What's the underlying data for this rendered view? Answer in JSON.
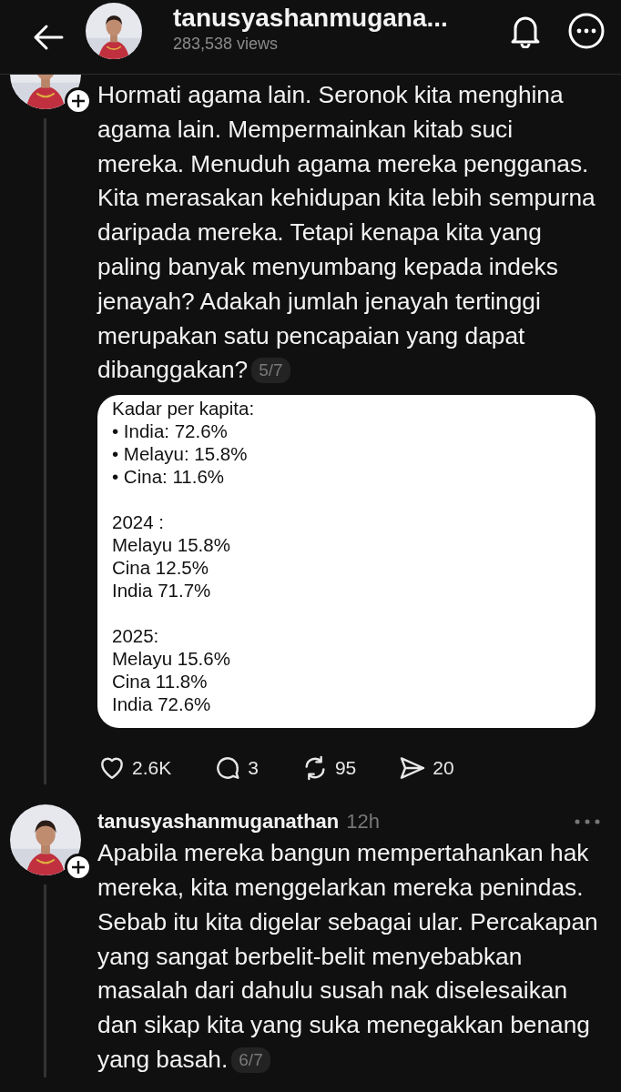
{
  "header": {
    "username": "tanusyashanmugana...",
    "views": "283,538 views"
  },
  "posts": [
    {
      "body": "Hormati agama lain. Seronok kita menghina agama lain. Mempermainkan kitab suci mereka. Menuduh agama mereka pengganas. Kita merasakan kehidupan kita lebih sempurna daripada mereka. Tetapi kenapa kita yang paling banyak menyumbang kepada indeks jenayah? Adakah jumlah jenayah tertinggi merupakan satu pencapaian yang dapat dibanggakan?",
      "counter": "5/7",
      "image_text": [
        [
          "Kadar per kapita:",
          "• India: 72.6%",
          "• Melayu: 15.8%",
          "• Cina: 11.6%"
        ],
        [
          "2024 :",
          "Melayu 15.8%",
          "Cina 12.5%",
          "India 71.7%"
        ],
        [
          "2025:",
          "Melayu 15.6%",
          "Cina 11.8%",
          "India 72.6%"
        ]
      ],
      "actions": [
        {
          "kind": "like",
          "count": "2.6K"
        },
        {
          "kind": "reply",
          "count": "3"
        },
        {
          "kind": "repost",
          "count": "95"
        },
        {
          "kind": "share",
          "count": "20"
        }
      ]
    },
    {
      "username": "tanusyashanmuganathan",
      "time": "12h",
      "body": "Apabila mereka bangun mempertahankan hak mereka, kita menggelarkan mereka penindas. Sebab itu kita digelar sebagai ular. Percakapan yang sangat berbelit-belit menyebabkan masalah dari dahulu susah nak diselesaikan dan sikap kita yang suka menegakkan benang yang basah.",
      "counter": "6/7"
    }
  ]
}
